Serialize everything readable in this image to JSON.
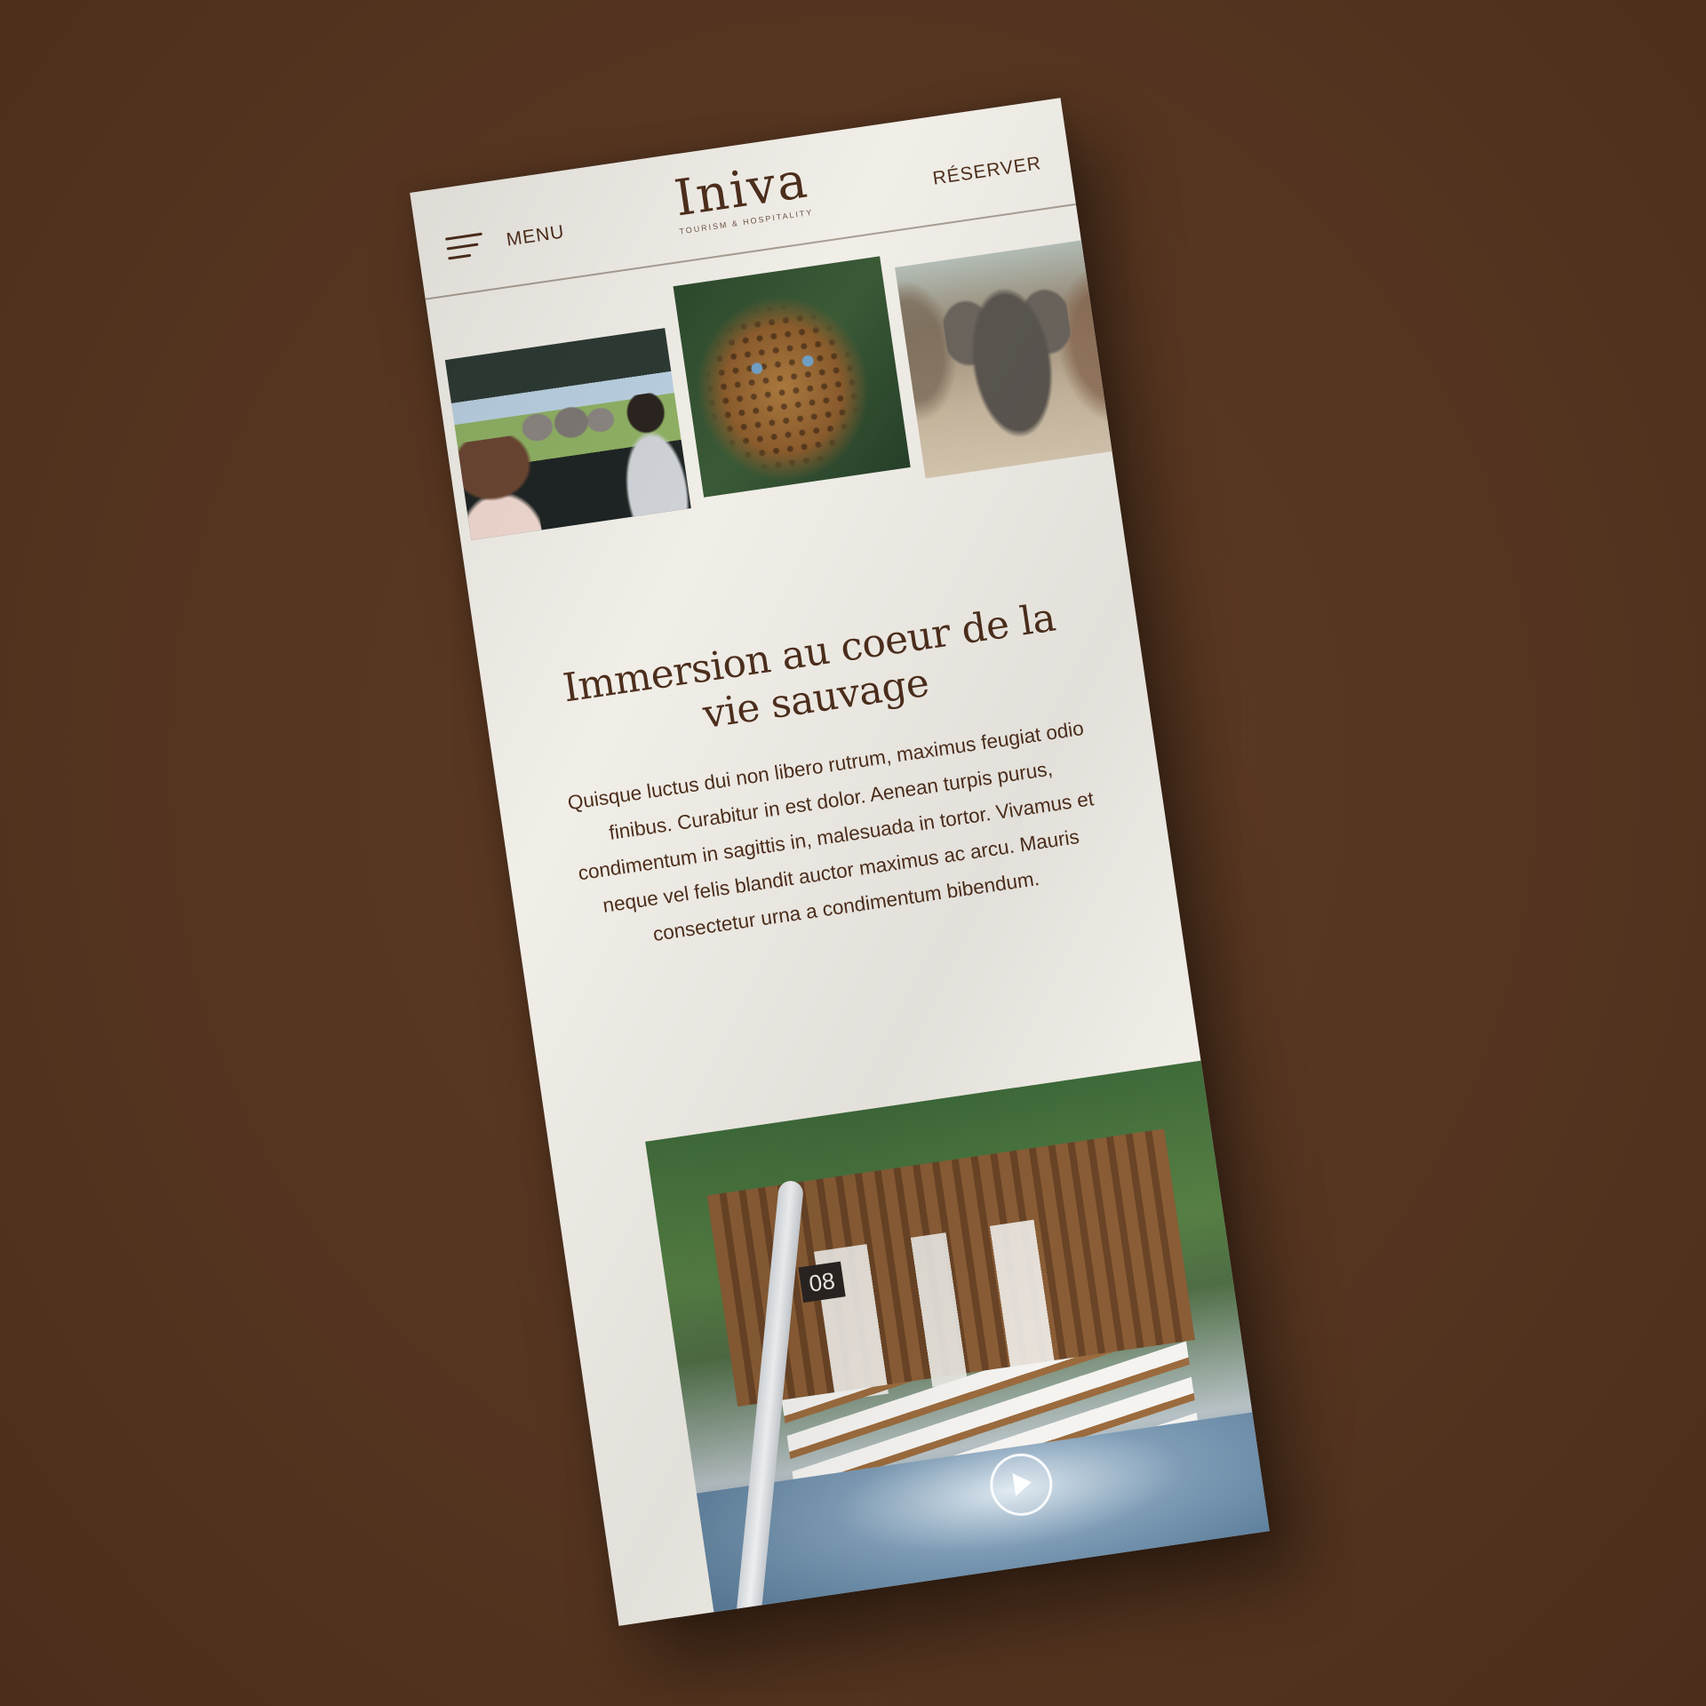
{
  "header": {
    "menu_label": "MENU",
    "menu_icon": "hamburger-icon",
    "logo_wordmark": "Iniva",
    "logo_tagline": "TOURISM & HOSPITALITY",
    "reserve_label": "RÉSERVER"
  },
  "gallery": {
    "photos": [
      {
        "subject": "safari vehicle watching elephants"
      },
      {
        "subject": "leopard portrait"
      },
      {
        "subject": "elephant on a path"
      }
    ]
  },
  "main": {
    "headline": "Immersion au coeur de la vie sauvage",
    "body": "Quisque luctus dui non libero rutrum, maximus feugiat odio finibus. Curabitur in est dolor. Aenean turpis purus, condimentum in sagittis in, malesuada in tortor. Vivamus et neque vel felis blandit auctor maximus ac arcu. Mauris consectetur urna a condimentum bibendum."
  },
  "video": {
    "sign_number": "08",
    "play_icon": "play-icon"
  },
  "colors": {
    "background": "#553520",
    "page": "#f1eee8",
    "text": "#4d2e1c"
  }
}
